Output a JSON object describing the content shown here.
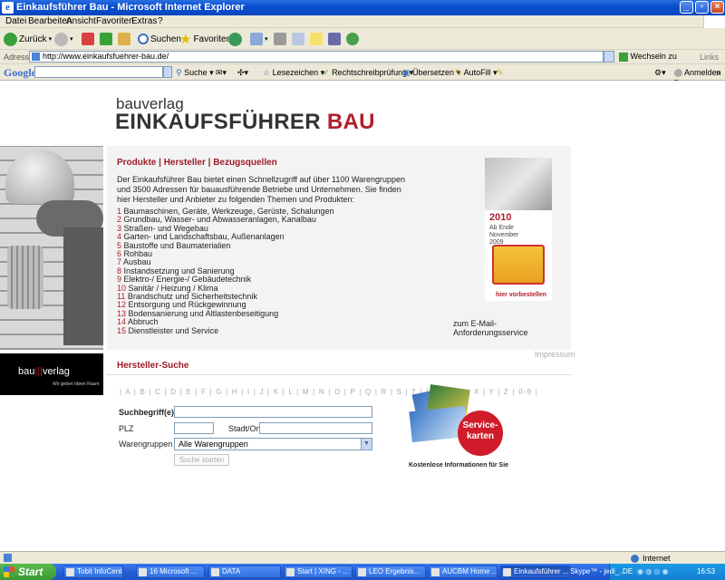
{
  "window": {
    "title": "Einkaufsführer Bau - Microsoft Internet Explorer"
  },
  "menu": [
    "Datei",
    "Bearbeiten",
    "Ansicht",
    "Favoriten",
    "Extras",
    "?"
  ],
  "toolbar": {
    "back": "Zurück",
    "search": "Suchen",
    "favorites": "Favoriten"
  },
  "address": {
    "label": "Adresse",
    "url": "http://www.einkaufsfuehrer-bau.de/",
    "go": "Wechseln zu",
    "links": "Links"
  },
  "google_bar": {
    "logo": "Google",
    "search": "Suche",
    "bookmarks": "Lesezeichen",
    "spellcheck": "Rechtschreibprüfung",
    "translate": "Übersetzen",
    "autofill": "AutoFill",
    "signin": "Anmelden"
  },
  "page": {
    "logo_small": "bauverlag",
    "logo_main": "EINKAUFSFÜHRER",
    "logo_accent": "BAU",
    "nav": [
      "Produkte",
      "Hersteller",
      "Bezugsquellen"
    ],
    "intro": "Der Einkaufsführer Bau bietet einen Schnellzugriff auf über 1100 Warengruppen und 3500 Adressen für bauausführende Betriebe und Unternehmen. Sie finden hier Hersteller und Anbieter zu folgenden Themen und Produkten:",
    "topics": [
      {
        "num": "1",
        "label": "Baumaschinen, Geräte, Werkzeuge, Gerüste, Schalungen"
      },
      {
        "num": "2",
        "label": "Grundbau, Wasser- und Abwasseranlagen, Kanalbau"
      },
      {
        "num": "3",
        "label": "Straßen- und Wegebau"
      },
      {
        "num": "4",
        "label": "Garten- und Landschaftsbau, Außenanlagen"
      },
      {
        "num": "5",
        "label": "Baustoffe und Baumaterialien"
      },
      {
        "num": "6",
        "label": "Rohbau"
      },
      {
        "num": "7",
        "label": "Ausbau"
      },
      {
        "num": "8",
        "label": "Instandsetzung und Sanierung"
      },
      {
        "num": "9",
        "label": "Elektro-/ Energie-/ Gebäudetechnik"
      },
      {
        "num": "10",
        "label": "Sanitär / Heizung / Klima"
      },
      {
        "num": "11",
        "label": "Brandschutz und Sicherheitstechnik"
      },
      {
        "num": "12",
        "label": "Entsorgung und Rückgewinnung"
      },
      {
        "num": "13",
        "label": "Bodensanierung und Altlastenbeseitigung"
      },
      {
        "num": "14",
        "label": "Abbruch"
      },
      {
        "num": "15",
        "label": "Dienstleister und Service"
      }
    ],
    "catalog": {
      "year": "2010",
      "sub": "Ab Ende November 2009",
      "order": "hier vorbestellen"
    },
    "email_link": "zum E-Mail-Anforderungsservice",
    "impressum": "Impressum",
    "bv_logo": {
      "left": "bau",
      "bars": "|||",
      "right": "verlag",
      "tag": "Wir geben Ideen Raum"
    },
    "search": {
      "title": "Hersteller-Suche",
      "alphabet": "| A | B | C | D | E | F | G | H | I | J | K | L | M | N | O | P | Q | R | S | T | U | V | W | X | Y | Z | 0-9 |",
      "keyword_label": "Suchbegriff(e)",
      "plz_label": "PLZ",
      "city_label": "Stadt/Ort",
      "group_label": "Warengruppen",
      "group_value": "Alle Warengruppen",
      "submit": "Suche starten"
    },
    "service": {
      "badge": "Service-karten",
      "caption": "Kostenlose Informationen für Sie"
    }
  },
  "statusbar": {
    "zone": "Internet"
  },
  "taskbar": {
    "start": "Start",
    "tasks": [
      "Tobit InfoCenter",
      "16 Microsoft ...",
      "DATA",
      "Start | XING - ...",
      "LEO Ergebnis...",
      "AUCBM Home ...",
      "Einkaufsführer ...",
      "Skype™ - jedi_..."
    ],
    "lang": "DE",
    "clock": "16:53"
  }
}
